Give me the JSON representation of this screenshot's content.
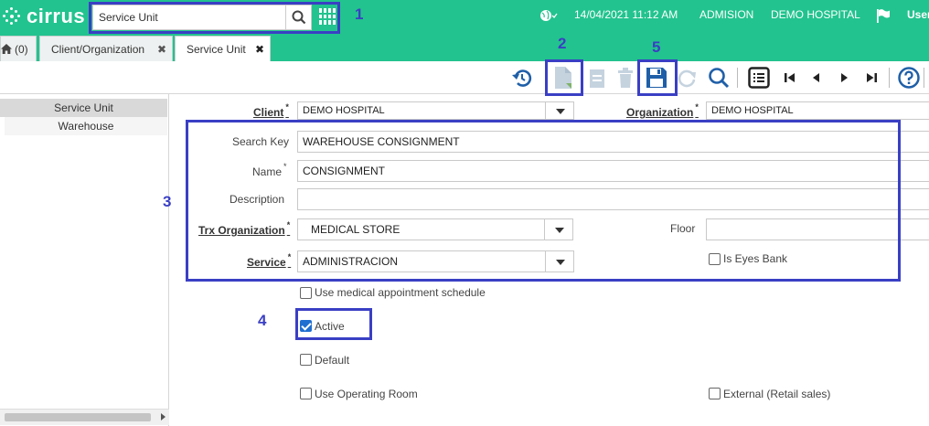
{
  "header": {
    "brand": "cirrus",
    "search_value": "Service Unit",
    "datetime": "14/04/2021 11:12 AM",
    "role": "ADMISION",
    "organization": "DEMO HOSPITAL",
    "user": "User"
  },
  "tabs": {
    "home_count": "(0)",
    "items": [
      {
        "label": "Client/Organization"
      },
      {
        "label": "Service Unit"
      }
    ],
    "close_glyph": "✖"
  },
  "tree": {
    "header": "Service Unit",
    "items": [
      {
        "label": "Warehouse"
      }
    ]
  },
  "form": {
    "client": {
      "label": "Client",
      "value": "DEMO HOSPITAL"
    },
    "organization": {
      "label": "Organization",
      "value": "DEMO HOSPITAL"
    },
    "search_key": {
      "label": "Search Key",
      "value": "WAREHOUSE CONSIGNMENT"
    },
    "name": {
      "label": "Name",
      "value": "CONSIGNMENT"
    },
    "description": {
      "label": "Description",
      "value": ""
    },
    "trx_organization": {
      "label": "Trx Organization",
      "value": "MEDICAL STORE"
    },
    "floor": {
      "label": "Floor",
      "value": ""
    },
    "service": {
      "label": "Service",
      "value": "ADMINISTRACION"
    },
    "is_eyes_bank": {
      "label": "Is Eyes Bank",
      "checked": false
    },
    "use_medical_schedule": {
      "label": "Use medical appointment schedule",
      "checked": false
    },
    "active": {
      "label": "Active",
      "checked": true
    },
    "default": {
      "label": "Default",
      "checked": false
    },
    "use_operating_room": {
      "label": "Use Operating Room",
      "checked": false
    },
    "external_retail": {
      "label": "External (Retail sales)",
      "checked": false
    },
    "required_mark": "*"
  },
  "annotations": {
    "n1": "1",
    "n2": "2",
    "n3": "3",
    "n4": "4",
    "n5": "5"
  },
  "colors": {
    "header_bg": "#22c38e",
    "annotation": "#3a3fc4",
    "toolbar_icon": "#1f5fa8",
    "toolbar_disabled": "#c5d3df"
  }
}
